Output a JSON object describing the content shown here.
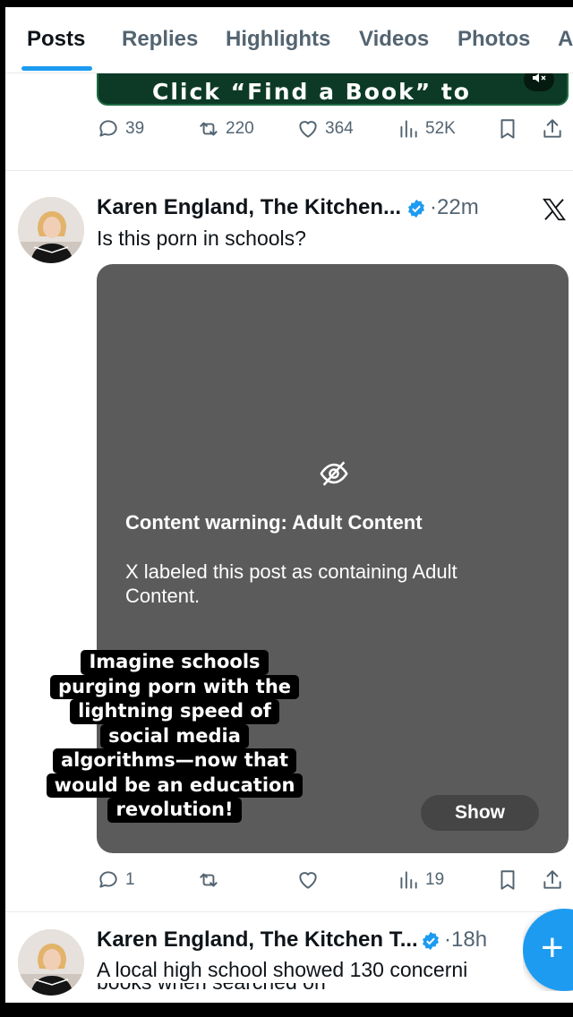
{
  "tabs": [
    {
      "label": "Posts",
      "active": true
    },
    {
      "label": "Replies",
      "active": false
    },
    {
      "label": "Highlights",
      "active": false
    },
    {
      "label": "Videos",
      "active": false
    },
    {
      "label": "Photos",
      "active": false
    },
    {
      "label": "A",
      "active": false
    }
  ],
  "prev_post": {
    "media_text": "Click “Find a Book” to",
    "volume_icon": "volume-muted-icon",
    "actions": {
      "replies": "39",
      "reposts": "220",
      "likes": "364",
      "views": "52K"
    }
  },
  "post1": {
    "author": "Karen England, The Kitchen...",
    "time": "·22m",
    "text": "Is this porn in schools?",
    "content_warning": {
      "icon": "eye-slash-icon",
      "title": "Content warning: Adult Content",
      "body": "X labeled this post as containing Adult Content.",
      "show_label": "Show"
    },
    "actions": {
      "replies": "1",
      "reposts": "",
      "likes": "",
      "views": "19"
    }
  },
  "post2": {
    "author": "Karen England, The Kitchen T...",
    "time": "·18h",
    "text_line1": "A local high school showed 130 concerni",
    "text_line2": "books when searched on"
  },
  "caption": {
    "lines": [
      "Imagine schools",
      "purging porn with the",
      "lightning speed of",
      "social media",
      "algorithms—now that",
      "would be an education",
      "revolution!"
    ]
  },
  "fab": {
    "icon": "plus-icon"
  },
  "colors": {
    "accent": "#1d9bf0",
    "media_bg": "#5b5b5b",
    "text_secondary": "#536471"
  }
}
